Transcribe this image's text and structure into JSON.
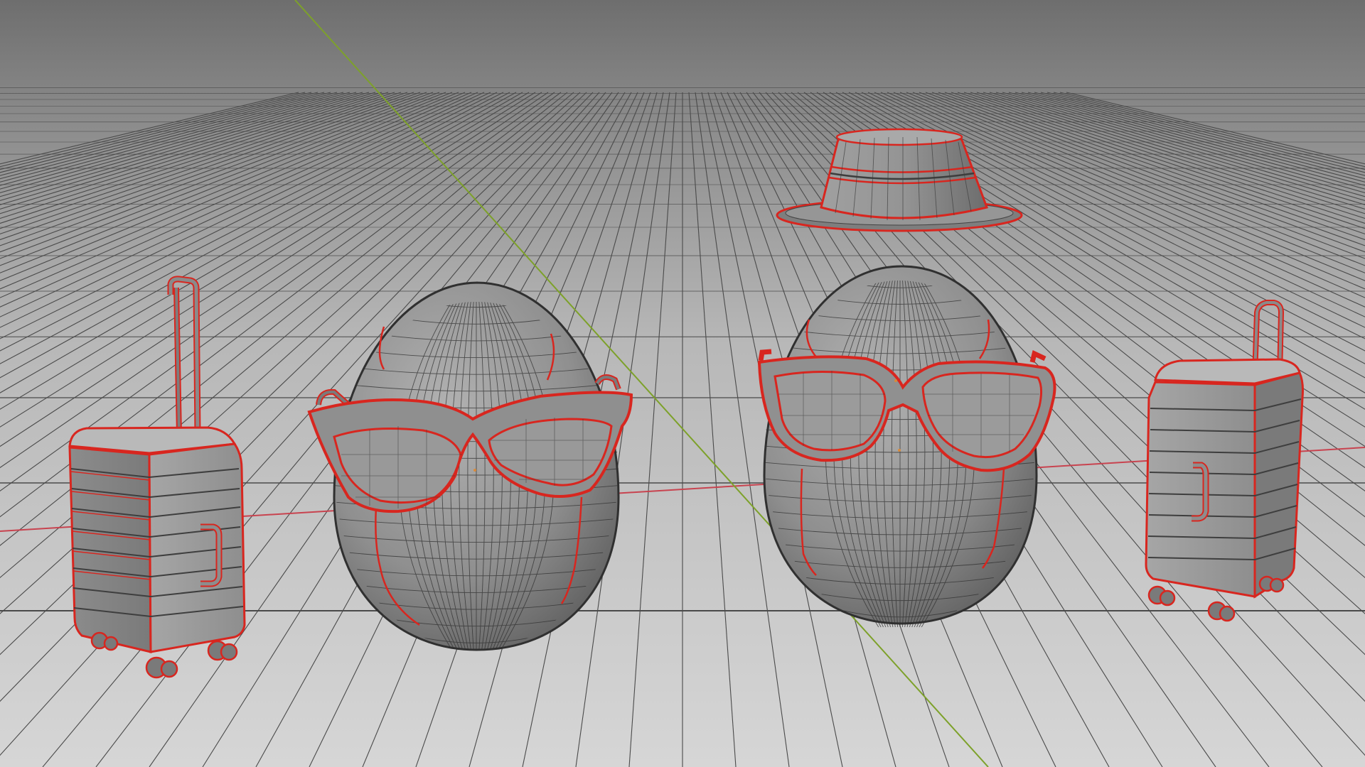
{
  "viewport": {
    "view": "3d-perspective",
    "shading": "solid",
    "wireframe_overlay": true,
    "selection_outline": true
  },
  "colors": {
    "background_far": "#6f6f6f",
    "background_mid": "#8c8c8c",
    "floor_near": "#d2d2d2",
    "grid_line": "#4a4a4a",
    "x_axis": "#c8434f",
    "y_axis": "#7da12a",
    "selection_outline": "#d8261f",
    "mesh_fill": "#9a9a9a",
    "mesh_shadow": "#5f5f5f"
  },
  "scene_objects": [
    {
      "name": "suitcase",
      "icon": "suitcase-icon"
    },
    {
      "name": "egg-with-cat-eye-sunglasses",
      "icon": "egg-icon"
    },
    {
      "name": "bucket-hat",
      "icon": "hat-icon"
    },
    {
      "name": "egg-with-square-sunglasses",
      "icon": "egg-icon"
    },
    {
      "name": "suitcase",
      "icon": "suitcase-icon"
    }
  ]
}
